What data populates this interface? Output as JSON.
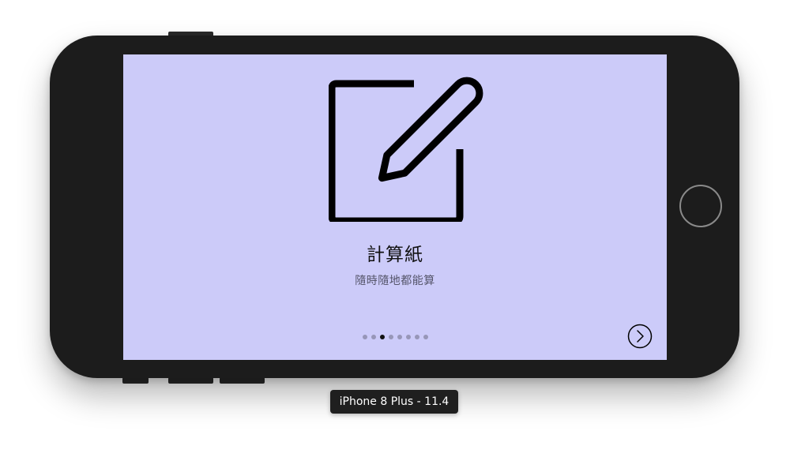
{
  "simulator": {
    "device_label": "iPhone 8 Plus - 11.4"
  },
  "onboarding": {
    "icon": "compose-pencil-icon",
    "title": "計算紙",
    "subtitle": "隨時隨地都能算",
    "page_count": 8,
    "current_page": 3,
    "next_icon": "chevron-right-circle-icon"
  },
  "colors": {
    "screen_background": "#cccbf9",
    "device_body": "#1c1c1c",
    "active_dot": "#111111",
    "inactive_dot": "#9796b8"
  }
}
